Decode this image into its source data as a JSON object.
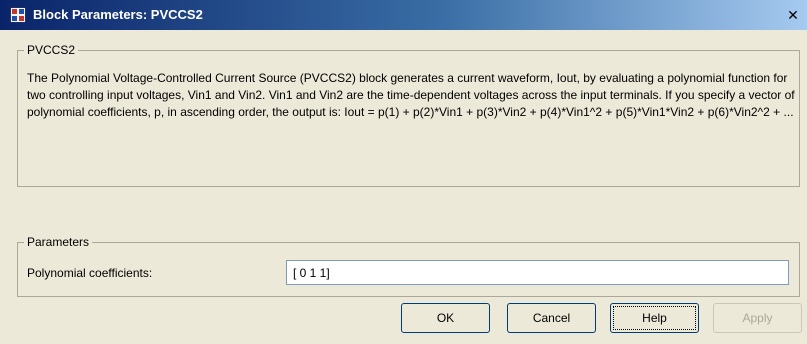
{
  "window": {
    "title": "Block Parameters: PVCCS2",
    "close_glyph": "✕"
  },
  "block_group": {
    "title": "PVCCS2",
    "description": "The Polynomial Voltage-Controlled Current Source (PVCCS2) block generates a current waveform, Iout, by evaluating a polynomial function for two controlling input voltages, Vin1 and Vin2. Vin1 and Vin2 are the time-dependent voltages across the input terminals. If you specify a vector of polynomial coefficients, p, in ascending order, the output is: Iout = p(1) + p(2)*Vin1 + p(3)*Vin2 + p(4)*Vin1^2 + p(5)*Vin1*Vin2 + p(6)*Vin2^2 + ..."
  },
  "parameters_group": {
    "title": "Parameters",
    "fields": [
      {
        "label": "Polynomial coefficients:",
        "value": "[ 0 1 1]"
      }
    ]
  },
  "buttons": {
    "ok": "OK",
    "cancel": "Cancel",
    "help": "Help",
    "apply": "Apply"
  },
  "icons": {
    "app": "simulink-block-icon",
    "close": "close-icon"
  },
  "colors": {
    "window_bg": "#ece9d8",
    "titlebar_start": "#0a246a",
    "titlebar_end": "#a6caf0",
    "group_border": "#aca899"
  }
}
